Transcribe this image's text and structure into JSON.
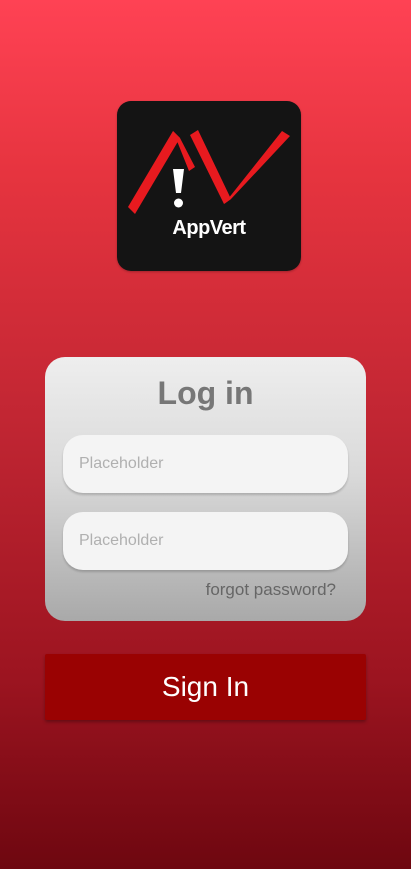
{
  "logo": {
    "text": "AppVert",
    "background": "#141414",
    "accent": "#e81a1f"
  },
  "login": {
    "title": "Log in",
    "field1": {
      "placeholder": "Placeholder",
      "value": ""
    },
    "field2": {
      "placeholder": "Placeholder",
      "value": ""
    },
    "forgot_label": "forgot password?"
  },
  "signin": {
    "label": "Sign In",
    "color": "#9a0202"
  }
}
